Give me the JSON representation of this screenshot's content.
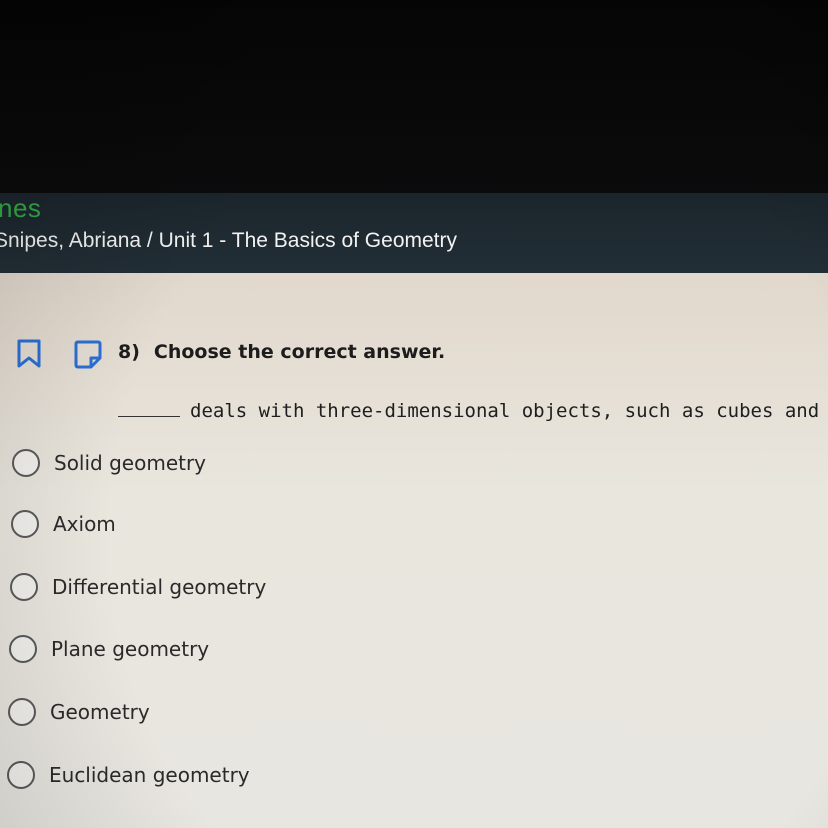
{
  "header": {
    "brand": "nes",
    "breadcrumb": "Snipes, Abriana / Unit 1 - The Basics of Geometry"
  },
  "question": {
    "number": "8)",
    "instruction": "Choose the correct answer.",
    "prompt": "deals with three-dimensional objects, such as cubes and sphere"
  },
  "options": [
    {
      "label": "Solid geometry"
    },
    {
      "label": "Axiom"
    },
    {
      "label": "Differential geometry"
    },
    {
      "label": "Plane geometry"
    },
    {
      "label": "Geometry"
    },
    {
      "label": "Euclidean geometry"
    }
  ],
  "colors": {
    "brand_green": "#34a845",
    "header_bg": "#1f2a31",
    "icon_blue": "#2b6fd6"
  },
  "icons": [
    "bookmark-icon",
    "note-icon"
  ]
}
